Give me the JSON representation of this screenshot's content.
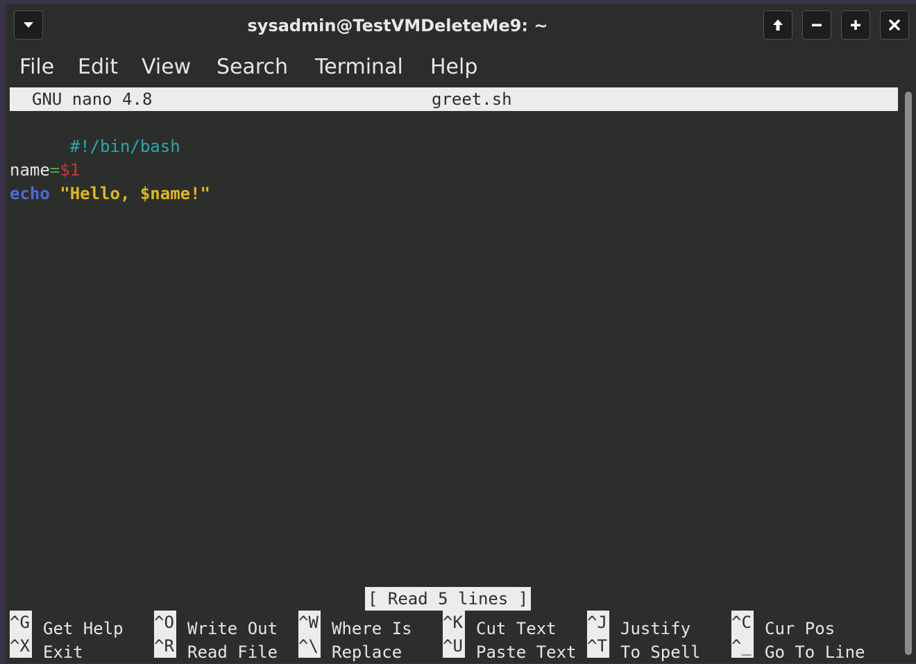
{
  "window": {
    "title": "sysadmin@TestVMDeleteMe9: ~",
    "menu_icon": "chevron-down-icon",
    "controls": {
      "up": "↑",
      "minimize": "−",
      "maximize": "+",
      "close": "✕"
    }
  },
  "menubar": {
    "items": [
      "File",
      "Edit",
      "View",
      "Search",
      "Terminal",
      "Help"
    ]
  },
  "nano": {
    "version": "GNU nano 4.8",
    "filename": "greet.sh",
    "lines": {
      "shebang": "#!/bin/bash",
      "name_var": "name",
      "name_eq": "=",
      "name_arg": "$1",
      "echo_kw": "echo",
      "echo_str": "\"Hello, $name!\""
    },
    "status": "[ Read 5 lines ]",
    "shortcuts_row1": [
      {
        "key": "^G",
        "label": "Get Help"
      },
      {
        "key": "^O",
        "label": "Write Out"
      },
      {
        "key": "^W",
        "label": "Where Is"
      },
      {
        "key": "^K",
        "label": "Cut Text"
      },
      {
        "key": "^J",
        "label": "Justify"
      },
      {
        "key": "^C",
        "label": "Cur Pos"
      }
    ],
    "shortcuts_row2": [
      {
        "key": "^X",
        "label": "Exit"
      },
      {
        "key": "^R",
        "label": "Read File"
      },
      {
        "key": "^\\",
        "label": "Replace"
      },
      {
        "key": "^U",
        "label": "Paste Text"
      },
      {
        "key": "^T",
        "label": "To Spell"
      },
      {
        "key": "^_",
        "label": "Go To Line"
      }
    ]
  },
  "colors": {
    "comment": "#2ba7b0",
    "operator": "#4fa843",
    "argument": "#d33131",
    "keyword": "#4b6bd8",
    "string": "#e0b819"
  }
}
